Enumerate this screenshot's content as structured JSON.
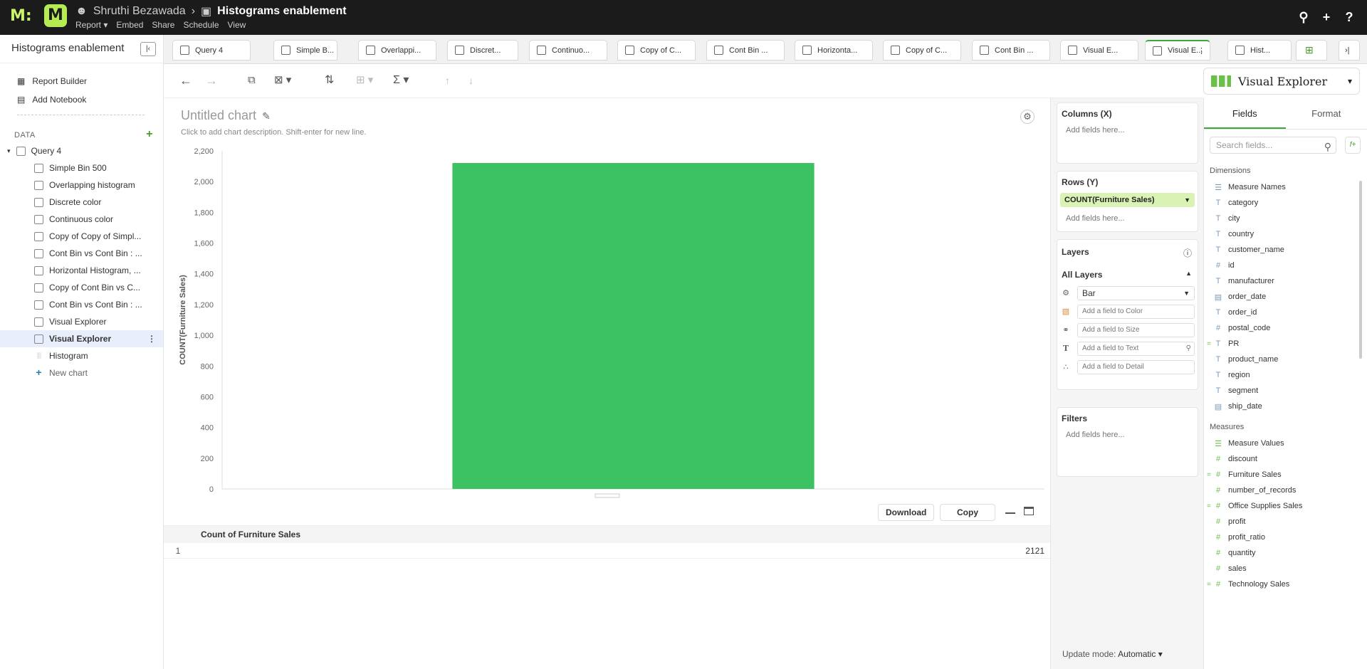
{
  "topbar": {
    "user": "Shruthi Bezawada",
    "report_title": "Histograms enablement",
    "menu": [
      "Report",
      "Embed",
      "Share",
      "Schedule",
      "View"
    ]
  },
  "sidebar": {
    "title": "Histograms enablement",
    "links": [
      {
        "label": "Report Builder"
      },
      {
        "label": "Add Notebook"
      }
    ],
    "data_label": "DATA",
    "query": "Query 4",
    "items": [
      {
        "label": "Simple Bin 500"
      },
      {
        "label": "Overlapping histogram"
      },
      {
        "label": "Discrete color"
      },
      {
        "label": "Continuous color"
      },
      {
        "label": "Copy of Copy of Simpl..."
      },
      {
        "label": "Cont Bin vs Cont Bin : ..."
      },
      {
        "label": "Horizontal Histogram, ..."
      },
      {
        "label": "Copy of Cont Bin vs C..."
      },
      {
        "label": "Cont Bin vs Cont Bin : ..."
      },
      {
        "label": "Visual Explorer"
      },
      {
        "label": "Visual Explorer"
      },
      {
        "label": "Histogram"
      }
    ],
    "new_chart": "New chart"
  },
  "tabs": [
    {
      "label": "Query 4"
    },
    {
      "label": "Simple B..."
    },
    {
      "label": "Overlappi..."
    },
    {
      "label": "Discret..."
    },
    {
      "label": "Continuo..."
    },
    {
      "label": "Copy of C..."
    },
    {
      "label": "Cont Bin ..."
    },
    {
      "label": "Horizonta..."
    },
    {
      "label": "Copy of C..."
    },
    {
      "label": "Cont Bin ..."
    },
    {
      "label": "Visual E..."
    },
    {
      "label": "Visual E..."
    },
    {
      "label": "Hist..."
    }
  ],
  "viz_selector": "Visual Explorer",
  "chart": {
    "title": "Untitled chart",
    "description": "Click to add chart description. Shift-enter for new line."
  },
  "chart_data": {
    "type": "bar",
    "categories": [
      ""
    ],
    "values": [
      2121
    ],
    "title": "",
    "xlabel": "",
    "ylabel": "COUNT(Furniture Sales)",
    "ylim": [
      0,
      2200
    ],
    "yticks": [
      "0",
      "200",
      "400",
      "600",
      "800",
      "1,000",
      "1,200",
      "1,400",
      "1,600",
      "1,800",
      "2,000",
      "2,200"
    ],
    "color": "#3cc163",
    "grid": false
  },
  "footer": {
    "download": "Download",
    "copy": "Copy"
  },
  "table": {
    "header": "Count of Furniture Sales",
    "rows": [
      {
        "index": "1",
        "value": "2121"
      }
    ]
  },
  "shelves": {
    "columns_title": "Columns (X)",
    "columns_placeholder": "Add fields here...",
    "rows_title": "Rows (Y)",
    "rows_pill": "COUNT(Furniture Sales)",
    "rows_placeholder": "Add fields here...",
    "layers_title": "Layers",
    "all_layers": "All Layers",
    "mark_type": "Bar",
    "color_field": "Add a field to Color",
    "size_field": "Add a field to Size",
    "text_field": "Add a field to Text",
    "detail_field": "Add a field to Detail",
    "filters_title": "Filters",
    "filters_placeholder": "Add fields here...",
    "update_label": "Update mode:",
    "update_value": "Automatic"
  },
  "fields_panel": {
    "tab_fields": "Fields",
    "tab_format": "Format",
    "search_placeholder": "Search fields...",
    "dimensions_label": "Dimensions",
    "dimensions": [
      "Measure Names",
      "category",
      "city",
      "country",
      "customer_name",
      "id",
      "manufacturer",
      "order_date",
      "order_id",
      "postal_code",
      "PR",
      "product_name",
      "region",
      "segment",
      "ship_date"
    ],
    "measures_label": "Measures",
    "measures": [
      "Measure Values",
      "discount",
      "Furniture Sales",
      "number_of_records",
      "Office Supplies Sales",
      "profit",
      "profit_ratio",
      "quantity",
      "sales",
      "Technology Sales"
    ]
  }
}
